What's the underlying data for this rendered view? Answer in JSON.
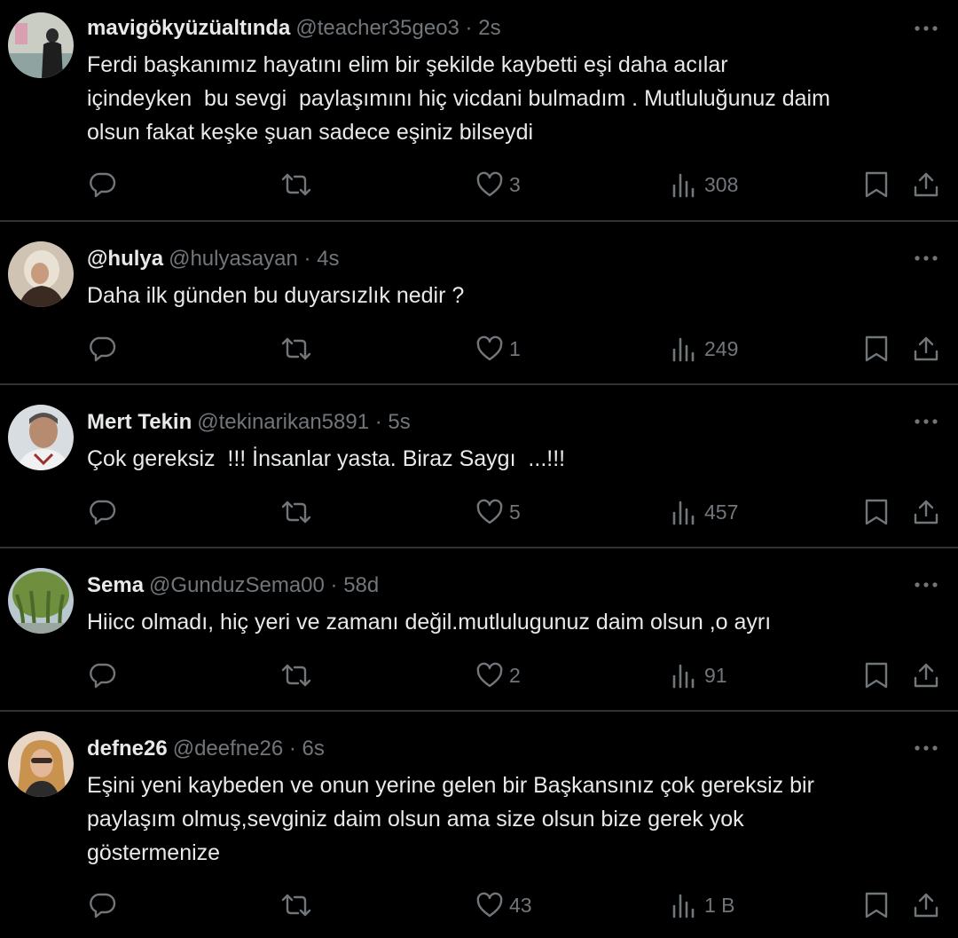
{
  "colors": {
    "background": "#000000",
    "primary_text": "#e7e9ea",
    "secondary_text": "#71767b",
    "divider": "#2f3336"
  },
  "icons": {
    "reply": "reply-icon",
    "retweet": "retweet-icon",
    "like": "heart-icon",
    "views": "analytics-icon",
    "bookmark": "bookmark-icon",
    "share": "share-icon",
    "more": "more-icon"
  },
  "tweets": [
    {
      "display_name": "mavigökyüzüaltında",
      "meta": "@teacher35geo3 · 2s",
      "text": "Ferdi başkanımız hayatını elim bir şekilde kaybetti eşi daha acılar\niçindeyken  bu sevgi  paylaşımını hiç vicdani bulmadım . Mutluluğunuz daim\nolsun fakat keşke şuan sadece eşiniz bilseydi",
      "likes": "3",
      "views": "308"
    },
    {
      "display_name": "@hulya",
      "meta": "@hulyasayan · 4s",
      "text": "Daha ilk günden bu duyarsızlık nedir ?",
      "likes": "1",
      "views": "249"
    },
    {
      "display_name": "Mert Tekin",
      "meta": "@tekinarikan5891 · 5s",
      "text": "Çok gereksiz  !!! İnsanlar yasta. Biraz Saygı  ...!!!",
      "likes": "5",
      "views": "457"
    },
    {
      "display_name": "Sema",
      "meta": "@GunduzSema00 · 58d",
      "text": "Hiicc olmadı, hiç yeri ve zamanı değil.mutlulugunuz daim olsun ,o ayrı",
      "likes": "2",
      "views": "91"
    },
    {
      "display_name": "defne26",
      "meta": "@deefne26 · 6s",
      "text": "Eşini yeni kaybeden ve onun yerine gelen bir Başkansınız çok gereksiz bir\npaylaşım olmuş,sevginiz daim olsun ama size olsun bize gerek yok\ngöstermenize",
      "likes": "43",
      "views": "1 B"
    }
  ]
}
